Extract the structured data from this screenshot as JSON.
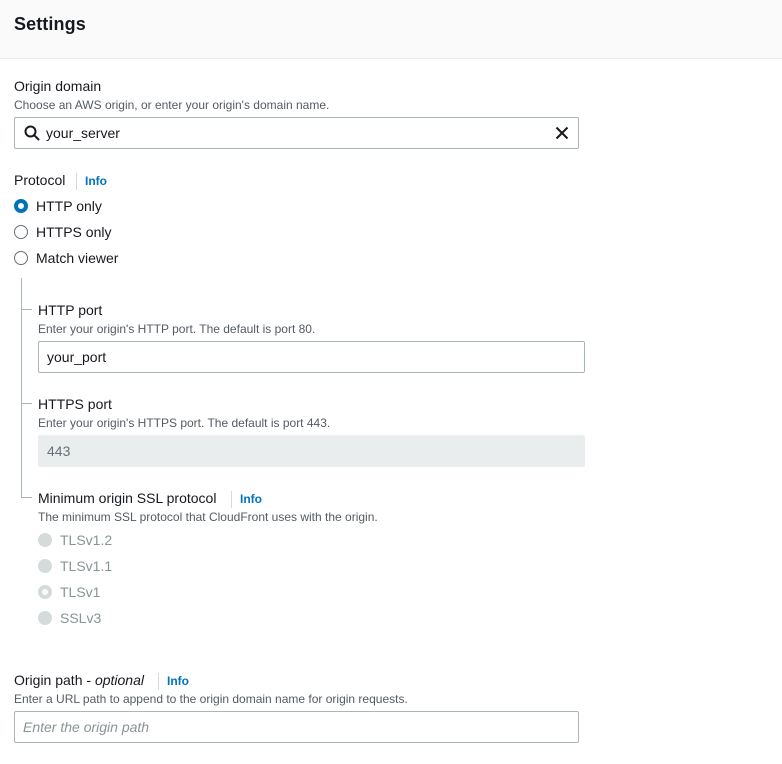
{
  "header": {
    "title": "Settings"
  },
  "origin_domain": {
    "label": "Origin domain",
    "description": "Choose an AWS origin, or enter your origin's domain name.",
    "value": "your_server"
  },
  "protocol": {
    "label": "Protocol",
    "info": "Info",
    "options": [
      {
        "label": "HTTP only",
        "checked": true
      },
      {
        "label": "HTTPS only",
        "checked": false
      },
      {
        "label": "Match viewer",
        "checked": false
      }
    ]
  },
  "http_port": {
    "label": "HTTP port",
    "description": "Enter your origin's HTTP port. The default is port 80.",
    "value": "your_port"
  },
  "https_port": {
    "label": "HTTPS port",
    "description": "Enter your origin's HTTPS port. The default is port 443.",
    "value": "443"
  },
  "ssl_protocol": {
    "label": "Minimum origin SSL protocol",
    "info": "Info",
    "description": "The minimum SSL protocol that CloudFront uses with the origin.",
    "options": [
      {
        "label": "TLSv1.2",
        "checked": false
      },
      {
        "label": "TLSv1.1",
        "checked": false
      },
      {
        "label": "TLSv1",
        "checked": true
      },
      {
        "label": "SSLv3",
        "checked": false
      }
    ]
  },
  "origin_path": {
    "label": "Origin path - ",
    "label_optional": "optional",
    "info": "Info",
    "description": "Enter a URL path to append to the origin domain name for origin requests.",
    "placeholder": "Enter the origin path"
  },
  "colors": {
    "accent": "#0073bb",
    "text": "#16191f",
    "muted": "#545b64",
    "disabled": "#879596"
  }
}
